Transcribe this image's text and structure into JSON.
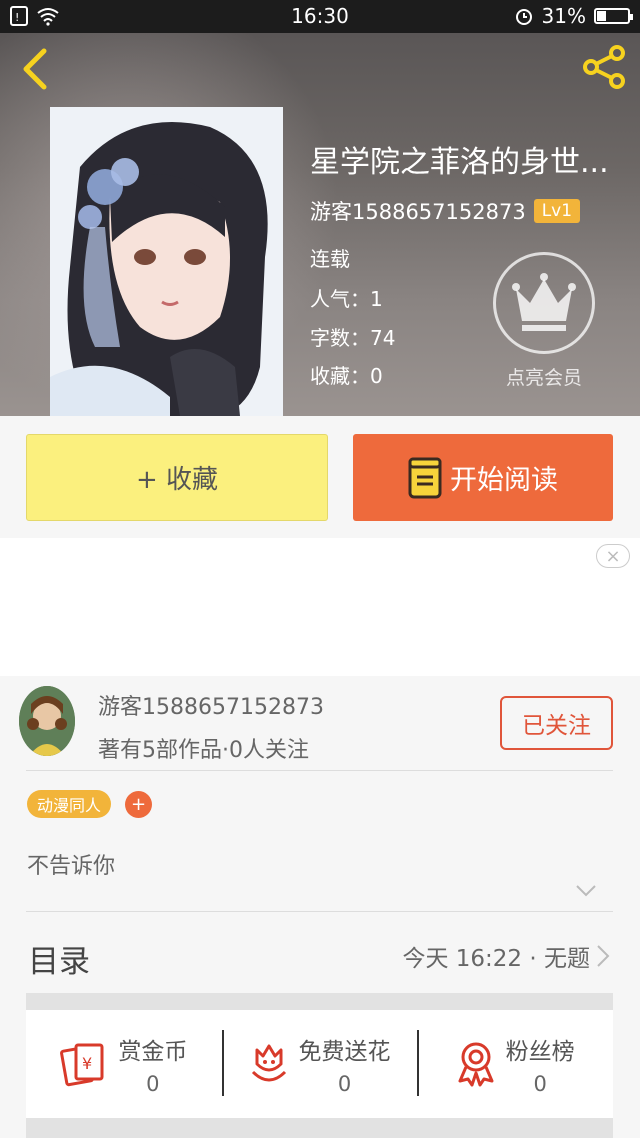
{
  "status_bar": {
    "time": "16:30",
    "battery": "31%",
    "battery_level": 0.31
  },
  "book": {
    "title": "星学院之菲洛的身世...",
    "author": "游客1588657152873",
    "level": "Lv1",
    "status": "连载",
    "popularity_label": "人气：1",
    "word_count_label": "字数：74",
    "favorites_label": "收藏：0",
    "vip_label": "点亮会员"
  },
  "actions": {
    "collect_label": "+ 收藏",
    "read_label": "开始阅读"
  },
  "ad": {
    "close_glyph": "×"
  },
  "author_card": {
    "name": "游客1588657152873",
    "subtitle": "著有5部作品·0人关注",
    "follow_label": "已关注",
    "tag": "动漫同人",
    "tag_add": "+",
    "description": "不告诉你"
  },
  "toc": {
    "label": "目录",
    "latest": "今天 16:22 · 无题"
  },
  "stats": [
    {
      "label": "赏金币",
      "value": "0",
      "icon": "red-envelope-icon"
    },
    {
      "label": "免费送花",
      "value": "0",
      "icon": "flower-icon"
    },
    {
      "label": "粉丝榜",
      "value": "0",
      "icon": "medal-icon"
    }
  ],
  "colors": {
    "accent": "#ee6a3c",
    "collect": "#fbf07e",
    "level": "#f2b43a",
    "follow": "#e0553a"
  }
}
